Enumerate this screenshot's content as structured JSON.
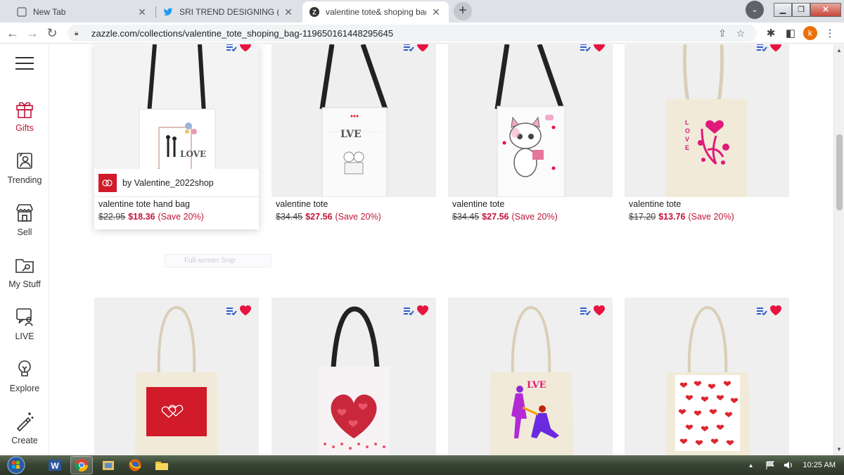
{
  "browser": {
    "tabs": [
      {
        "title": "New Tab",
        "icon": "new-tab-icon"
      },
      {
        "title": "SRI TREND DESIGNING (@designi",
        "icon": "twitter-icon"
      },
      {
        "title": "valentine tote& shoping bag",
        "icon": "zazzle-icon",
        "active": true
      }
    ],
    "url": "zazzle.com/collections/valentine_tote_shoping_bag-119650161448295645",
    "profile_initial": "k"
  },
  "rail": {
    "items": [
      {
        "label": "Gifts",
        "icon": "gift-icon",
        "active": true
      },
      {
        "label": "Trending",
        "icon": "trending-icon"
      },
      {
        "label": "Sell",
        "icon": "store-icon"
      },
      {
        "label": "My Stuff",
        "icon": "folder-icon"
      },
      {
        "label": "LIVE",
        "icon": "live-icon"
      },
      {
        "label": "Explore",
        "icon": "bulb-icon"
      },
      {
        "label": "Create",
        "icon": "magic-wand-icon"
      }
    ]
  },
  "products": [
    {
      "name": "valentine tote hand bag",
      "original_price": "$22.95",
      "sale_price": "$18.36",
      "save": "(Save 20%)",
      "seller": "by Valentine_2022shop"
    },
    {
      "name": "valentine tote",
      "original_price": "$34.45",
      "sale_price": "$27.56",
      "save": "(Save 20%)"
    },
    {
      "name": "valentine tote",
      "original_price": "$34.45",
      "sale_price": "$27.56",
      "save": "(Save 20%)"
    },
    {
      "name": "valentine tote",
      "original_price": "$17.20",
      "sale_price": "$13.76",
      "save": "(Save 20%)"
    },
    {
      "name": "",
      "original_price": "",
      "sale_price": "",
      "save": ""
    },
    {
      "name": "",
      "original_price": "",
      "sale_price": "",
      "save": ""
    },
    {
      "name": "",
      "original_price": "",
      "sale_price": "",
      "save": ""
    },
    {
      "name": "",
      "original_price": "",
      "sale_price": "",
      "save": ""
    }
  ],
  "overlay": {
    "snip_label": "Full-screen Snip"
  },
  "taskbar": {
    "time": "10:25 AM"
  },
  "colors": {
    "accent": "#c0153a",
    "heart": "#e8133f",
    "list_icon": "#2f5fd0"
  }
}
